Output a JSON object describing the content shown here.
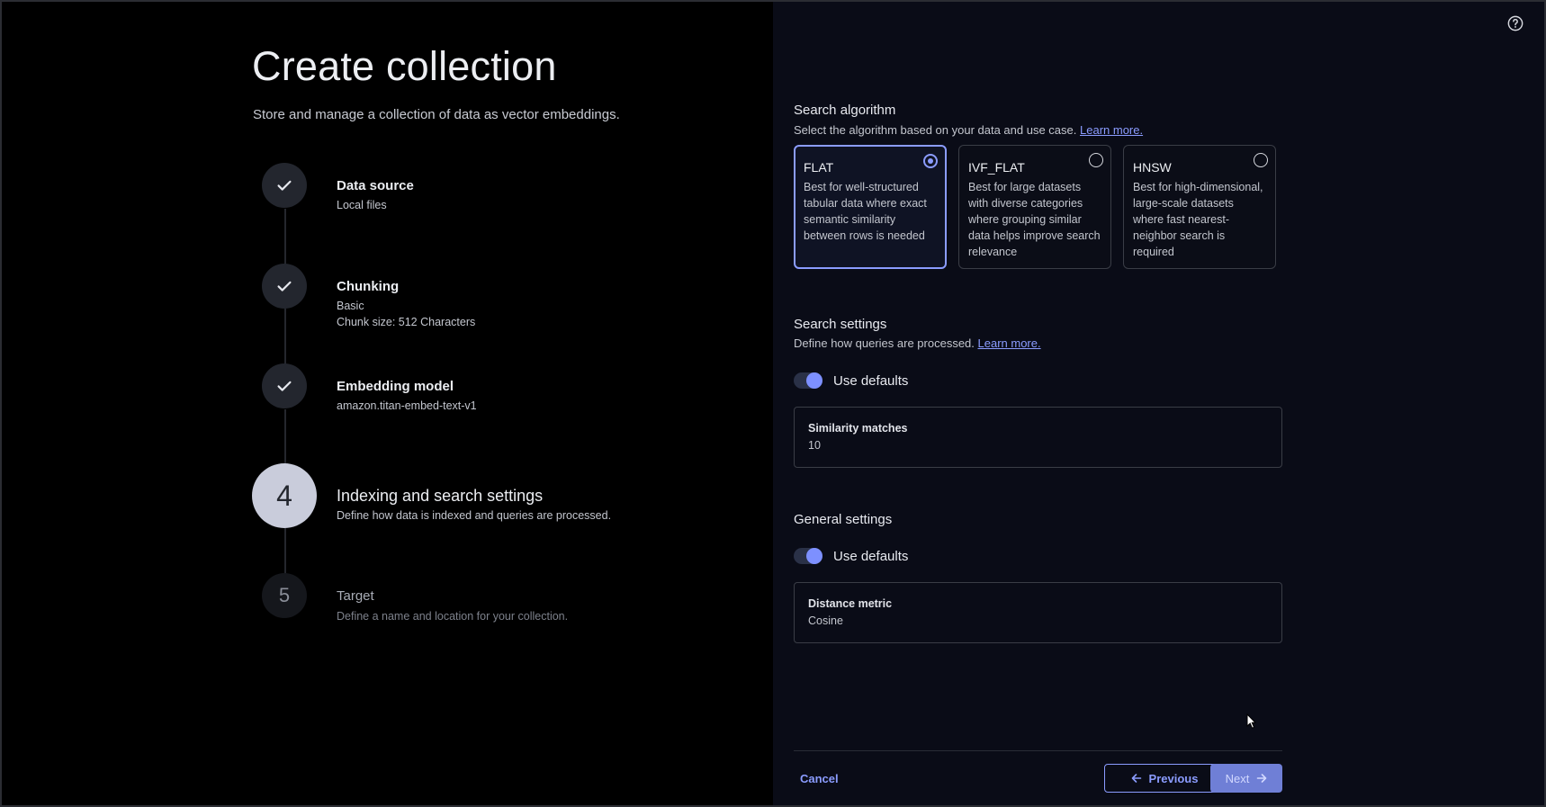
{
  "page": {
    "title": "Create collection",
    "subtitle": "Store and manage a collection of data as vector embeddings."
  },
  "steps": [
    {
      "status": "complete",
      "title": "Data source",
      "details": [
        "Local files"
      ]
    },
    {
      "status": "complete",
      "title": "Chunking",
      "details": [
        "Basic",
        "Chunk size: 512 Characters"
      ]
    },
    {
      "status": "complete",
      "title": "Embedding model",
      "details": [
        "amazon.titan-embed-text-v1"
      ]
    },
    {
      "status": "current",
      "number": "4",
      "title": "Indexing and search settings",
      "details": [
        "Define how data is indexed and queries are processed."
      ]
    },
    {
      "status": "upcoming",
      "number": "5",
      "title": "Target",
      "details": [
        "Define a name and location for your collection."
      ]
    }
  ],
  "search_algorithm": {
    "title": "Search algorithm",
    "description": "Select the algorithm based on your data and use case.",
    "link": "Learn more.",
    "options": [
      {
        "name": "FLAT",
        "selected": true,
        "description": "Best for well-structured tabular data where exact semantic similarity between rows is needed"
      },
      {
        "name": "IVF_FLAT",
        "selected": false,
        "description": "Best for large datasets with diverse categories where grouping similar data helps improve search relevance"
      },
      {
        "name": "HNSW",
        "selected": false,
        "description": "Best for high-dimensional, large-scale datasets where fast nearest-neighbor search is required"
      }
    ]
  },
  "search_settings": {
    "title": "Search settings",
    "description": "Define how queries are processed.",
    "link": "Learn more.",
    "toggle_label": "Use defaults",
    "toggle_on": true,
    "field_label": "Similarity matches",
    "field_value": "10"
  },
  "general_settings": {
    "title": "General settings",
    "toggle_label": "Use defaults",
    "toggle_on": true,
    "field_label": "Distance metric",
    "field_value": "Cosine"
  },
  "footer": {
    "cancel": "Cancel",
    "previous": "Previous",
    "next": "Next"
  },
  "colors": {
    "accent": "#8b9cff",
    "left_bg": "#000000",
    "right_bg": "#0a0c17"
  },
  "icons": [
    "check-icon",
    "help-icon",
    "arrow-left-icon",
    "arrow-right-icon",
    "cursor-icon"
  ]
}
